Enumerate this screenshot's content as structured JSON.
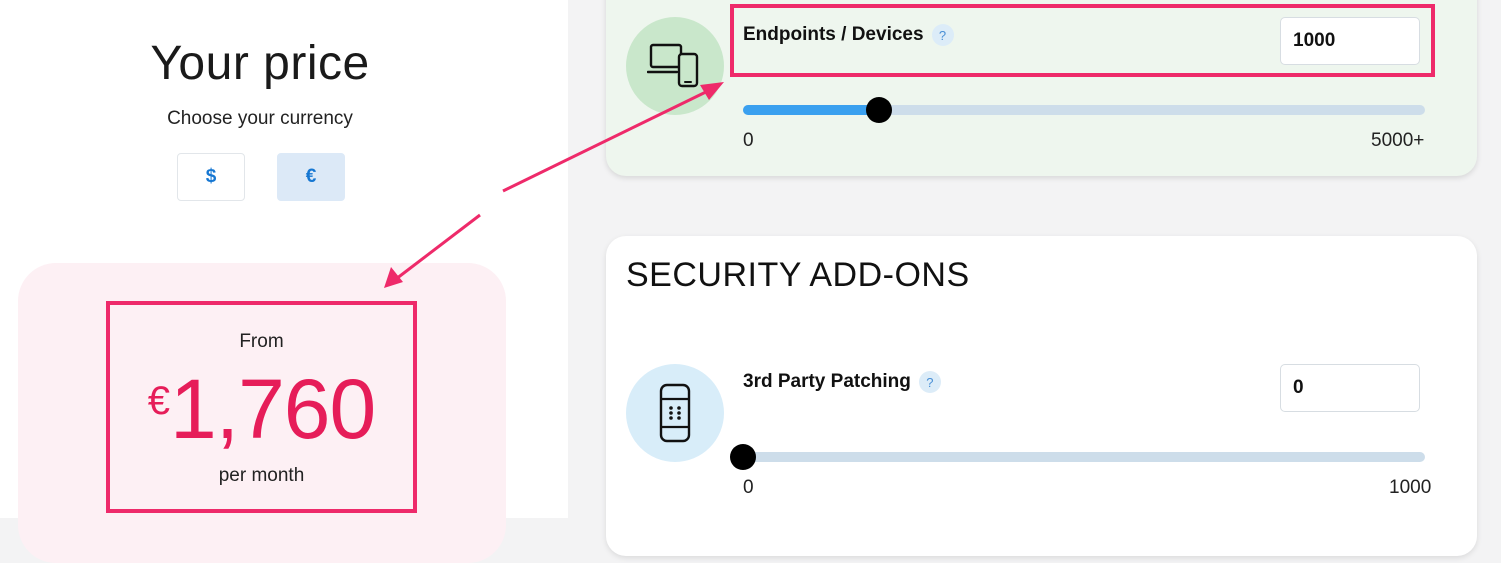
{
  "pricing": {
    "title": "Your price",
    "currency_prompt": "Choose your currency",
    "currencies": [
      "$",
      "€"
    ],
    "selected_currency": "€",
    "from_label": "From",
    "currency_symbol": "€",
    "amount": "1,760",
    "period": "per month"
  },
  "endpoints": {
    "label": "Endpoints / Devices",
    "help": "?",
    "value": "1000",
    "range_min": "0",
    "range_max": "5000+",
    "slider_fraction": 0.2,
    "icon": "devices-icon"
  },
  "security_addons": {
    "title": "SECURITY ADD-ONS",
    "patching": {
      "label": "3rd Party Patching",
      "help": "?",
      "value": "0",
      "range_min": "0",
      "range_max": "1000",
      "slider_fraction": 0,
      "icon": "patch-icon"
    }
  },
  "colors": {
    "highlight": "#ee2a6a",
    "price": "#e61d59",
    "accent": "#1677d2",
    "slider_fill": "#3aa0ef"
  }
}
